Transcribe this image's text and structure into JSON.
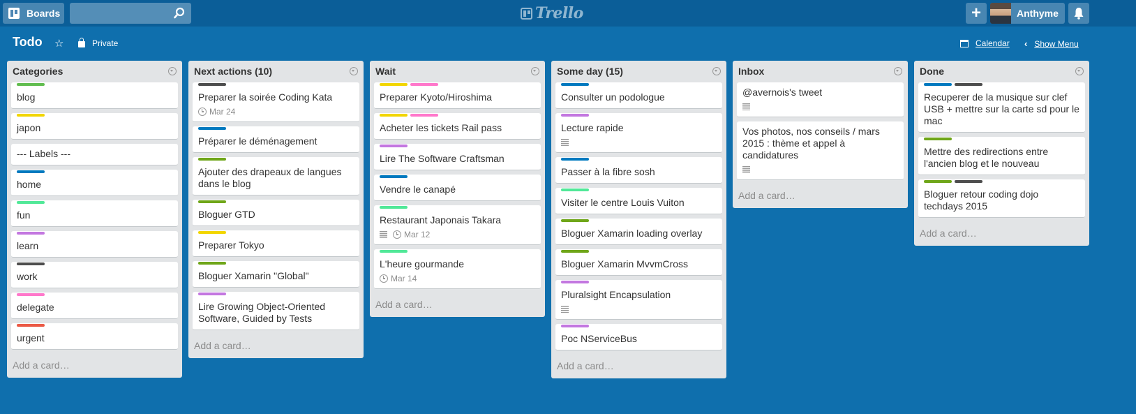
{
  "header": {
    "boards_label": "Boards",
    "search_placeholder": "",
    "logo_text": "Trello",
    "user_name": "Anthyme",
    "add_label": "+"
  },
  "board": {
    "title": "Todo",
    "visibility": "Private",
    "calendar_label": "Calendar",
    "show_menu_label": "Show Menu"
  },
  "colors": {
    "green": "#61bd4f",
    "yellow": "#f2d600",
    "blue": "#0079bf",
    "teal": "#51e898",
    "purple": "#c377e0",
    "black": "#4d4d4d",
    "pink": "#ff78cb",
    "red": "#eb5a46",
    "olive": "#6fa619"
  },
  "lists": [
    {
      "title": "Categories",
      "add_label": "Add a card…",
      "cards": [
        {
          "text": "blog",
          "labels": [
            "#61bd4f"
          ]
        },
        {
          "text": "japon",
          "labels": [
            "#f2d600"
          ]
        },
        {
          "text": "--- Labels ---",
          "labels": []
        },
        {
          "text": "home",
          "labels": [
            "#0079bf"
          ]
        },
        {
          "text": "fun",
          "labels": [
            "#51e898"
          ]
        },
        {
          "text": "learn",
          "labels": [
            "#c377e0"
          ]
        },
        {
          "text": "work",
          "labels": [
            "#4d4d4d"
          ]
        },
        {
          "text": "delegate",
          "labels": [
            "#ff78cb"
          ]
        },
        {
          "text": "urgent",
          "labels": [
            "#eb5a46"
          ]
        }
      ]
    },
    {
      "title": "Next actions (10)",
      "add_label": "Add a card…",
      "cards": [
        {
          "text": "Preparer la soirée Coding Kata",
          "labels": [
            "#4d4d4d"
          ],
          "due": "Mar 24"
        },
        {
          "text": "Préparer le déménagement",
          "labels": [
            "#0079bf"
          ]
        },
        {
          "text": "Ajouter des drapeaux de langues dans le blog",
          "labels": [
            "#6fa619"
          ]
        },
        {
          "text": "Bloguer GTD",
          "labels": [
            "#6fa619"
          ]
        },
        {
          "text": "Preparer Tokyo",
          "labels": [
            "#f2d600"
          ]
        },
        {
          "text": "Bloguer Xamarin \"Global\"",
          "labels": [
            "#6fa619"
          ]
        },
        {
          "text": "Lire Growing Object-Oriented Software, Guided by Tests",
          "labels": [
            "#c377e0"
          ]
        }
      ]
    },
    {
      "title": "Wait",
      "add_label": "Add a card…",
      "cards": [
        {
          "text": "Preparer Kyoto/Hiroshima",
          "labels": [
            "#f2d600",
            "#ff78cb"
          ]
        },
        {
          "text": "Acheter les tickets Rail pass",
          "labels": [
            "#f2d600",
            "#ff78cb"
          ]
        },
        {
          "text": "Lire The Software Craftsman",
          "labels": [
            "#c377e0"
          ]
        },
        {
          "text": "Vendre le canapé",
          "labels": [
            "#0079bf"
          ]
        },
        {
          "text": "Restaurant Japonais Takara",
          "labels": [
            "#51e898"
          ],
          "desc": true,
          "due": "Mar 12"
        },
        {
          "text": "L'heure gourmande",
          "labels": [
            "#51e898"
          ],
          "due": "Mar 14"
        }
      ]
    },
    {
      "title": "Some day (15)",
      "add_label": "Add a card…",
      "cards": [
        {
          "text": "Consulter un podologue",
          "labels": [
            "#0079bf"
          ]
        },
        {
          "text": "Lecture rapide",
          "labels": [
            "#c377e0"
          ],
          "desc": true
        },
        {
          "text": "Passer à la fibre sosh",
          "labels": [
            "#0079bf"
          ]
        },
        {
          "text": "Visiter le centre Louis Vuiton",
          "labels": [
            "#51e898"
          ]
        },
        {
          "text": "Bloguer Xamarin loading overlay",
          "labels": [
            "#6fa619"
          ]
        },
        {
          "text": "Bloguer Xamarin MvvmCross",
          "labels": [
            "#6fa619"
          ]
        },
        {
          "text": "Pluralsight Encapsulation",
          "labels": [
            "#c377e0"
          ],
          "desc": true
        },
        {
          "text": "Poc NServiceBus",
          "labels": [
            "#c377e0"
          ]
        }
      ]
    },
    {
      "title": "Inbox",
      "add_label": "Add a card…",
      "cards": [
        {
          "text": "@avernois's tweet",
          "labels": [],
          "desc": true
        },
        {
          "text": "Vos photos, nos conseils / mars 2015 : thème et appel à candidatures",
          "labels": [],
          "desc": true
        }
      ]
    },
    {
      "title": "Done",
      "add_label": "Add a card…",
      "cards": [
        {
          "text": "Recuperer de la musique sur clef USB + mettre sur la carte sd pour le mac",
          "labels": [
            "#0079bf",
            "#4d4d4d"
          ]
        },
        {
          "text": "Mettre des redirections entre l'ancien blog et le nouveau",
          "labels": [
            "#6fa619"
          ]
        },
        {
          "text": "Bloguer retour coding dojo techdays 2015",
          "labels": [
            "#6fa619",
            "#4d4d4d"
          ]
        }
      ]
    }
  ]
}
